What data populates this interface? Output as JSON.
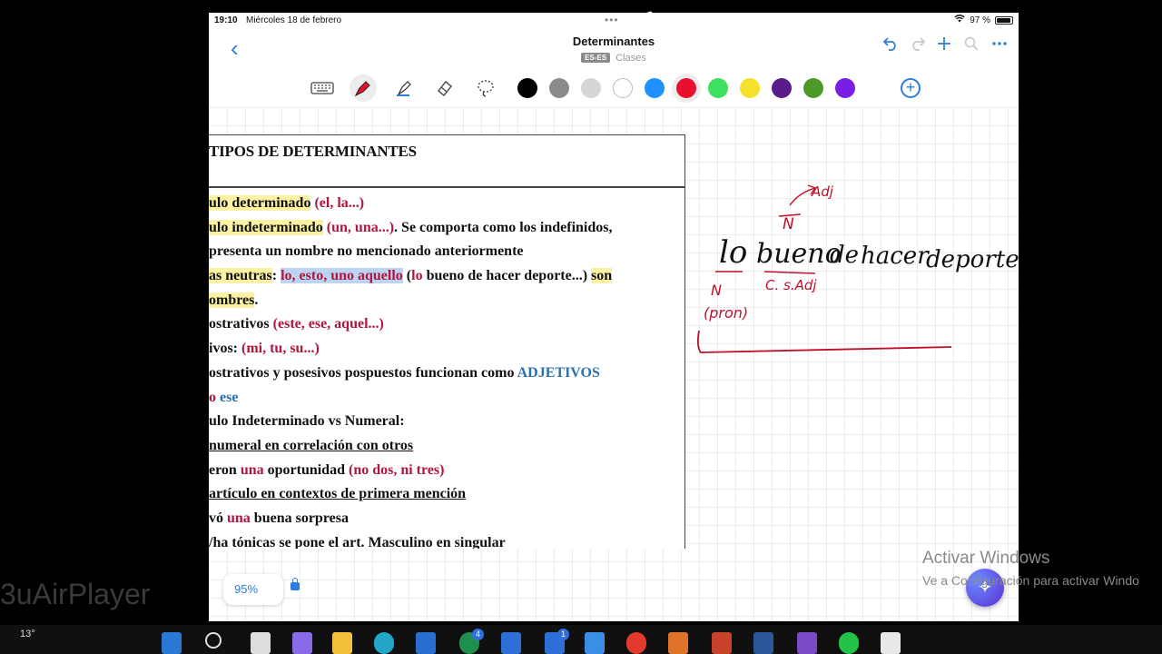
{
  "status": {
    "time": "19:10",
    "date": "Miércoles 18 de febrero",
    "dots": "•••",
    "battery": "97 %"
  },
  "header": {
    "title": "Determinantes",
    "lang": "ES-ES",
    "folder": "Clases",
    "back": "‹"
  },
  "toolbar": {
    "colors": [
      "#000000",
      "#8a8a8a",
      "#d6d6d6",
      "#ffffff",
      "#1e90ff",
      "#e8102e",
      "#3ee060",
      "#f5e12a",
      "#5a1a8a",
      "#4c9a2a",
      "#7a1ee6"
    ],
    "selected_color": "#e8102e"
  },
  "doc": {
    "heading": "TIPOS DE DETERMINANTES",
    "lines": [
      [
        [
          "hl",
          "ulo determinado"
        ],
        [
          "n",
          " "
        ],
        [
          "r",
          "(el, la...)"
        ]
      ],
      [
        [
          "hl",
          "ulo indeterminado"
        ],
        [
          "n",
          " "
        ],
        [
          "r",
          "(un, una...)"
        ],
        [
          "n",
          ". Se comporta como los indefinidos,"
        ]
      ],
      [
        [
          "n",
          "presenta un nombre no mencionado anteriormente"
        ]
      ],
      [
        [
          "hl",
          "as neutras"
        ],
        [
          "n",
          ": "
        ],
        [
          "hbr",
          "lo, esto, uno aquello"
        ],
        [
          "n",
          " ("
        ],
        [
          "r",
          "lo"
        ],
        [
          "n",
          " bueno de hacer deporte...) "
        ],
        [
          "hl",
          "son"
        ]
      ],
      [
        [
          "hl",
          "ombres"
        ],
        [
          "n",
          "."
        ]
      ],
      [
        [
          "n",
          "ostrativos "
        ],
        [
          "r",
          "(este, ese, aquel...)"
        ]
      ],
      [
        [
          "n",
          "ivos: "
        ],
        [
          "r",
          "(mi, tu, su...)"
        ]
      ],
      [
        [
          "n",
          "ostrativos y posesivos pospuestos funcionan como "
        ],
        [
          "b",
          "ADJETIVOS"
        ]
      ],
      [
        [
          "r",
          "o"
        ],
        [
          "n",
          " "
        ],
        [
          "b",
          "ese"
        ]
      ],
      [
        [
          "n",
          "ulo Indeterminado vs Numeral:"
        ]
      ],
      [
        [
          "u",
          "numeral en correlación con otros"
        ]
      ],
      [
        [
          "n",
          "eron "
        ],
        [
          "r",
          "una"
        ],
        [
          "n",
          " oportunidad "
        ],
        [
          "r",
          "(no dos, ni tres)"
        ]
      ],
      [
        [
          "u",
          "artículo en contextos de primera mención"
        ]
      ],
      [
        [
          "n",
          "vó "
        ],
        [
          "r",
          "una"
        ],
        [
          "n",
          " buena sorpresa"
        ]
      ],
      [
        [
          "n",
          "/ha tónicas se pone el art. Masculino en singular"
        ]
      ]
    ]
  },
  "ink": {
    "sentence_words": [
      "lo",
      "bueno",
      "de",
      "hacer",
      "deporte"
    ],
    "label_n_top": "N",
    "label_adj": "Adj",
    "label_n_bottom": "N",
    "label_pron": "(pron)",
    "label_csadj": "C. s.Adj"
  },
  "zoom": {
    "value": "95%"
  },
  "windows": {
    "watermark": "Activar Windows",
    "watermark_sub": "Ve a Configuración para activar Windo"
  },
  "mirror": {
    "label": "3uAirPlayer"
  },
  "taskbar": {
    "weather": "13°",
    "badge1": "4",
    "badge2": "1"
  }
}
